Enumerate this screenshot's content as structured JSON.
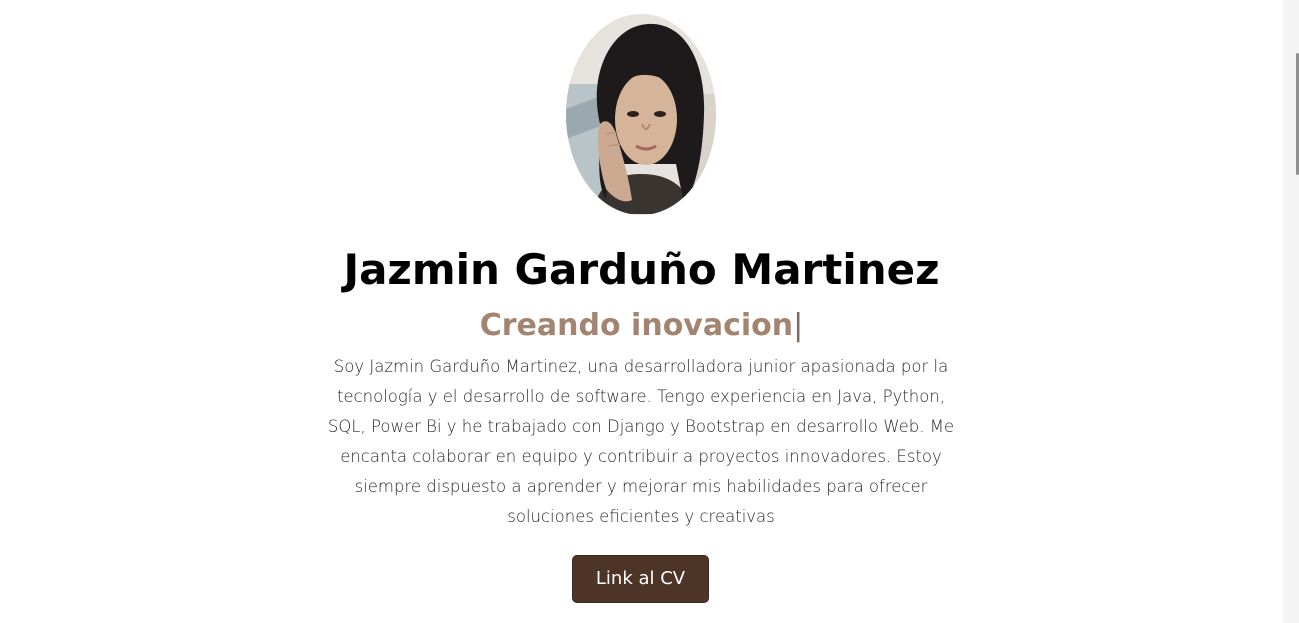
{
  "profile": {
    "photo_icon": "profile-photo",
    "name": "Jazmin Garduño Martinez",
    "tagline_prefix": "Creando",
    "tagline_typed": "inovacion",
    "tagline_cursor": "|",
    "bio": "Soy Jazmin Garduño Martinez, una desarrolladora junior apasionada por la tecnología y el desarrollo de software. Tengo experiencia en Java, Python, SQL, Power Bi y he trabajado con Django y Bootstrap en desarrollo Web. Me encanta colaborar en equipo y contribuir a proyectos innovadores. Estoy siempre dispuesto a aprender y mejorar mis habilidades para ofrecer soluciones eficientes y creativas",
    "cv_button_label": "Link al CV"
  },
  "colors": {
    "accent": "#a38470",
    "button_bg": "#4e3427",
    "text": "#000000",
    "background": "#ffffff"
  }
}
